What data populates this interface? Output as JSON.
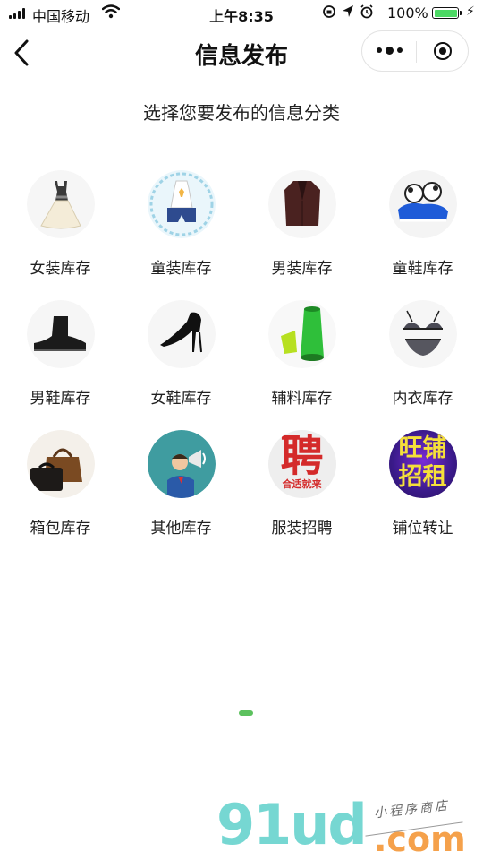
{
  "status_bar": {
    "carrier": "中国移动",
    "time": "上午8:35",
    "battery": "100%"
  },
  "nav": {
    "title": "信息发布"
  },
  "subtitle": "选择您要发布的信息分类",
  "categories": [
    {
      "label": "女装库存",
      "icon": "dress-icon"
    },
    {
      "label": "童装库存",
      "icon": "kids-clothes-icon"
    },
    {
      "label": "男装库存",
      "icon": "mens-jacket-icon"
    },
    {
      "label": "童鞋库存",
      "icon": "kids-shoe-icon"
    },
    {
      "label": "男鞋库存",
      "icon": "mens-boot-icon"
    },
    {
      "label": "女鞋库存",
      "icon": "high-heel-icon"
    },
    {
      "label": "辅料库存",
      "icon": "thread-spool-icon"
    },
    {
      "label": "内衣库存",
      "icon": "lingerie-icon"
    },
    {
      "label": "箱包库存",
      "icon": "bags-icon"
    },
    {
      "label": "其他库存",
      "icon": "megaphone-man-icon"
    },
    {
      "label": "服装招聘",
      "icon": "recruit-icon",
      "icon_text": "聘",
      "icon_caption": "合适就来"
    },
    {
      "label": "铺位转让",
      "icon": "shop-transfer-icon",
      "icon_text_top": "旺铺",
      "icon_text_bottom": "招租"
    }
  ],
  "watermark": {
    "main": "91ud",
    "domain": ".com",
    "tagline": "小程序商店"
  },
  "colors": {
    "accent_green": "#5cc15e",
    "battery_green": "#4cd964"
  }
}
